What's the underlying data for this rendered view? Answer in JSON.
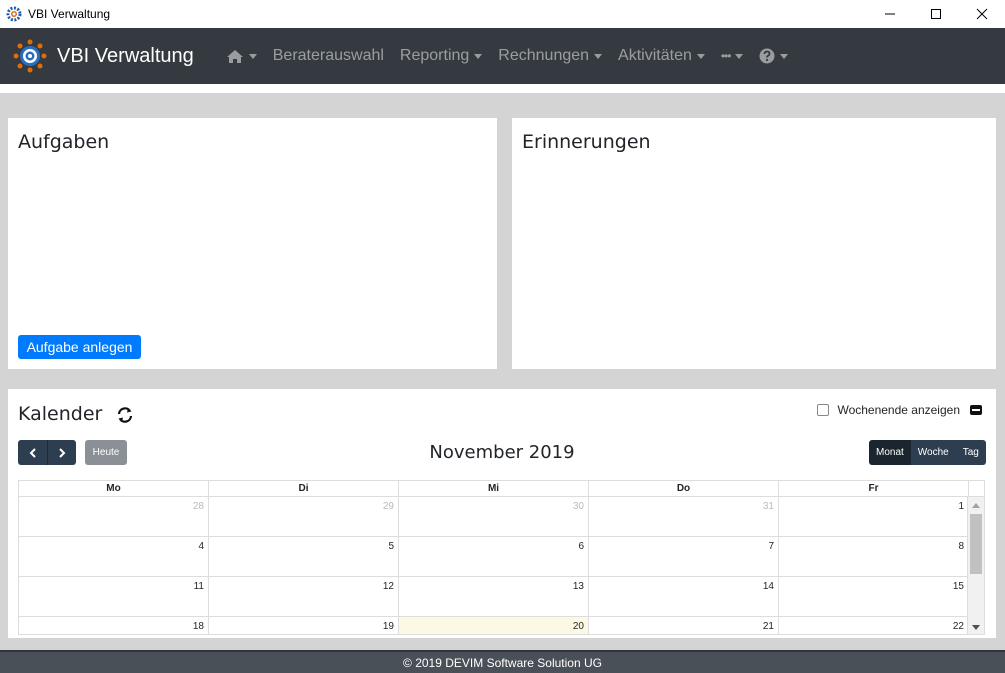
{
  "window": {
    "title": "VBI Verwaltung"
  },
  "brand": {
    "name": "VBI Verwaltung"
  },
  "nav": {
    "items": [
      "Beraterauswahl",
      "Reporting",
      "Rechnungen",
      "Aktivitäten"
    ],
    "more_label": "•••"
  },
  "aufgaben": {
    "title": "Aufgaben",
    "button_label": "Aufgabe anlegen"
  },
  "erinnerungen": {
    "title": "Erinnerungen"
  },
  "calendar": {
    "title": "Kalender",
    "weekend_label": "Wochenende anzeigen",
    "today_label": "Heute",
    "month_title": "November 2019",
    "views": [
      "Monat",
      "Woche",
      "Tag"
    ],
    "active_view": "Monat",
    "weekdays": [
      "Mo",
      "Di",
      "Mi",
      "Do",
      "Fr"
    ],
    "weeks": [
      [
        "28",
        "29",
        "30",
        "31",
        "1"
      ],
      [
        "4",
        "5",
        "6",
        "7",
        "8"
      ],
      [
        "11",
        "12",
        "13",
        "14",
        "15"
      ],
      [
        "18",
        "19",
        "20",
        "21",
        "22"
      ]
    ],
    "today": "20"
  },
  "footer": {
    "text": "© 2019 DEVIM Software Solution UG"
  },
  "colors": {
    "navbar": "#343a40",
    "primary": "#007bff",
    "calendar_button": "#2c3e50",
    "today_highlight": "#fcf8e3"
  }
}
